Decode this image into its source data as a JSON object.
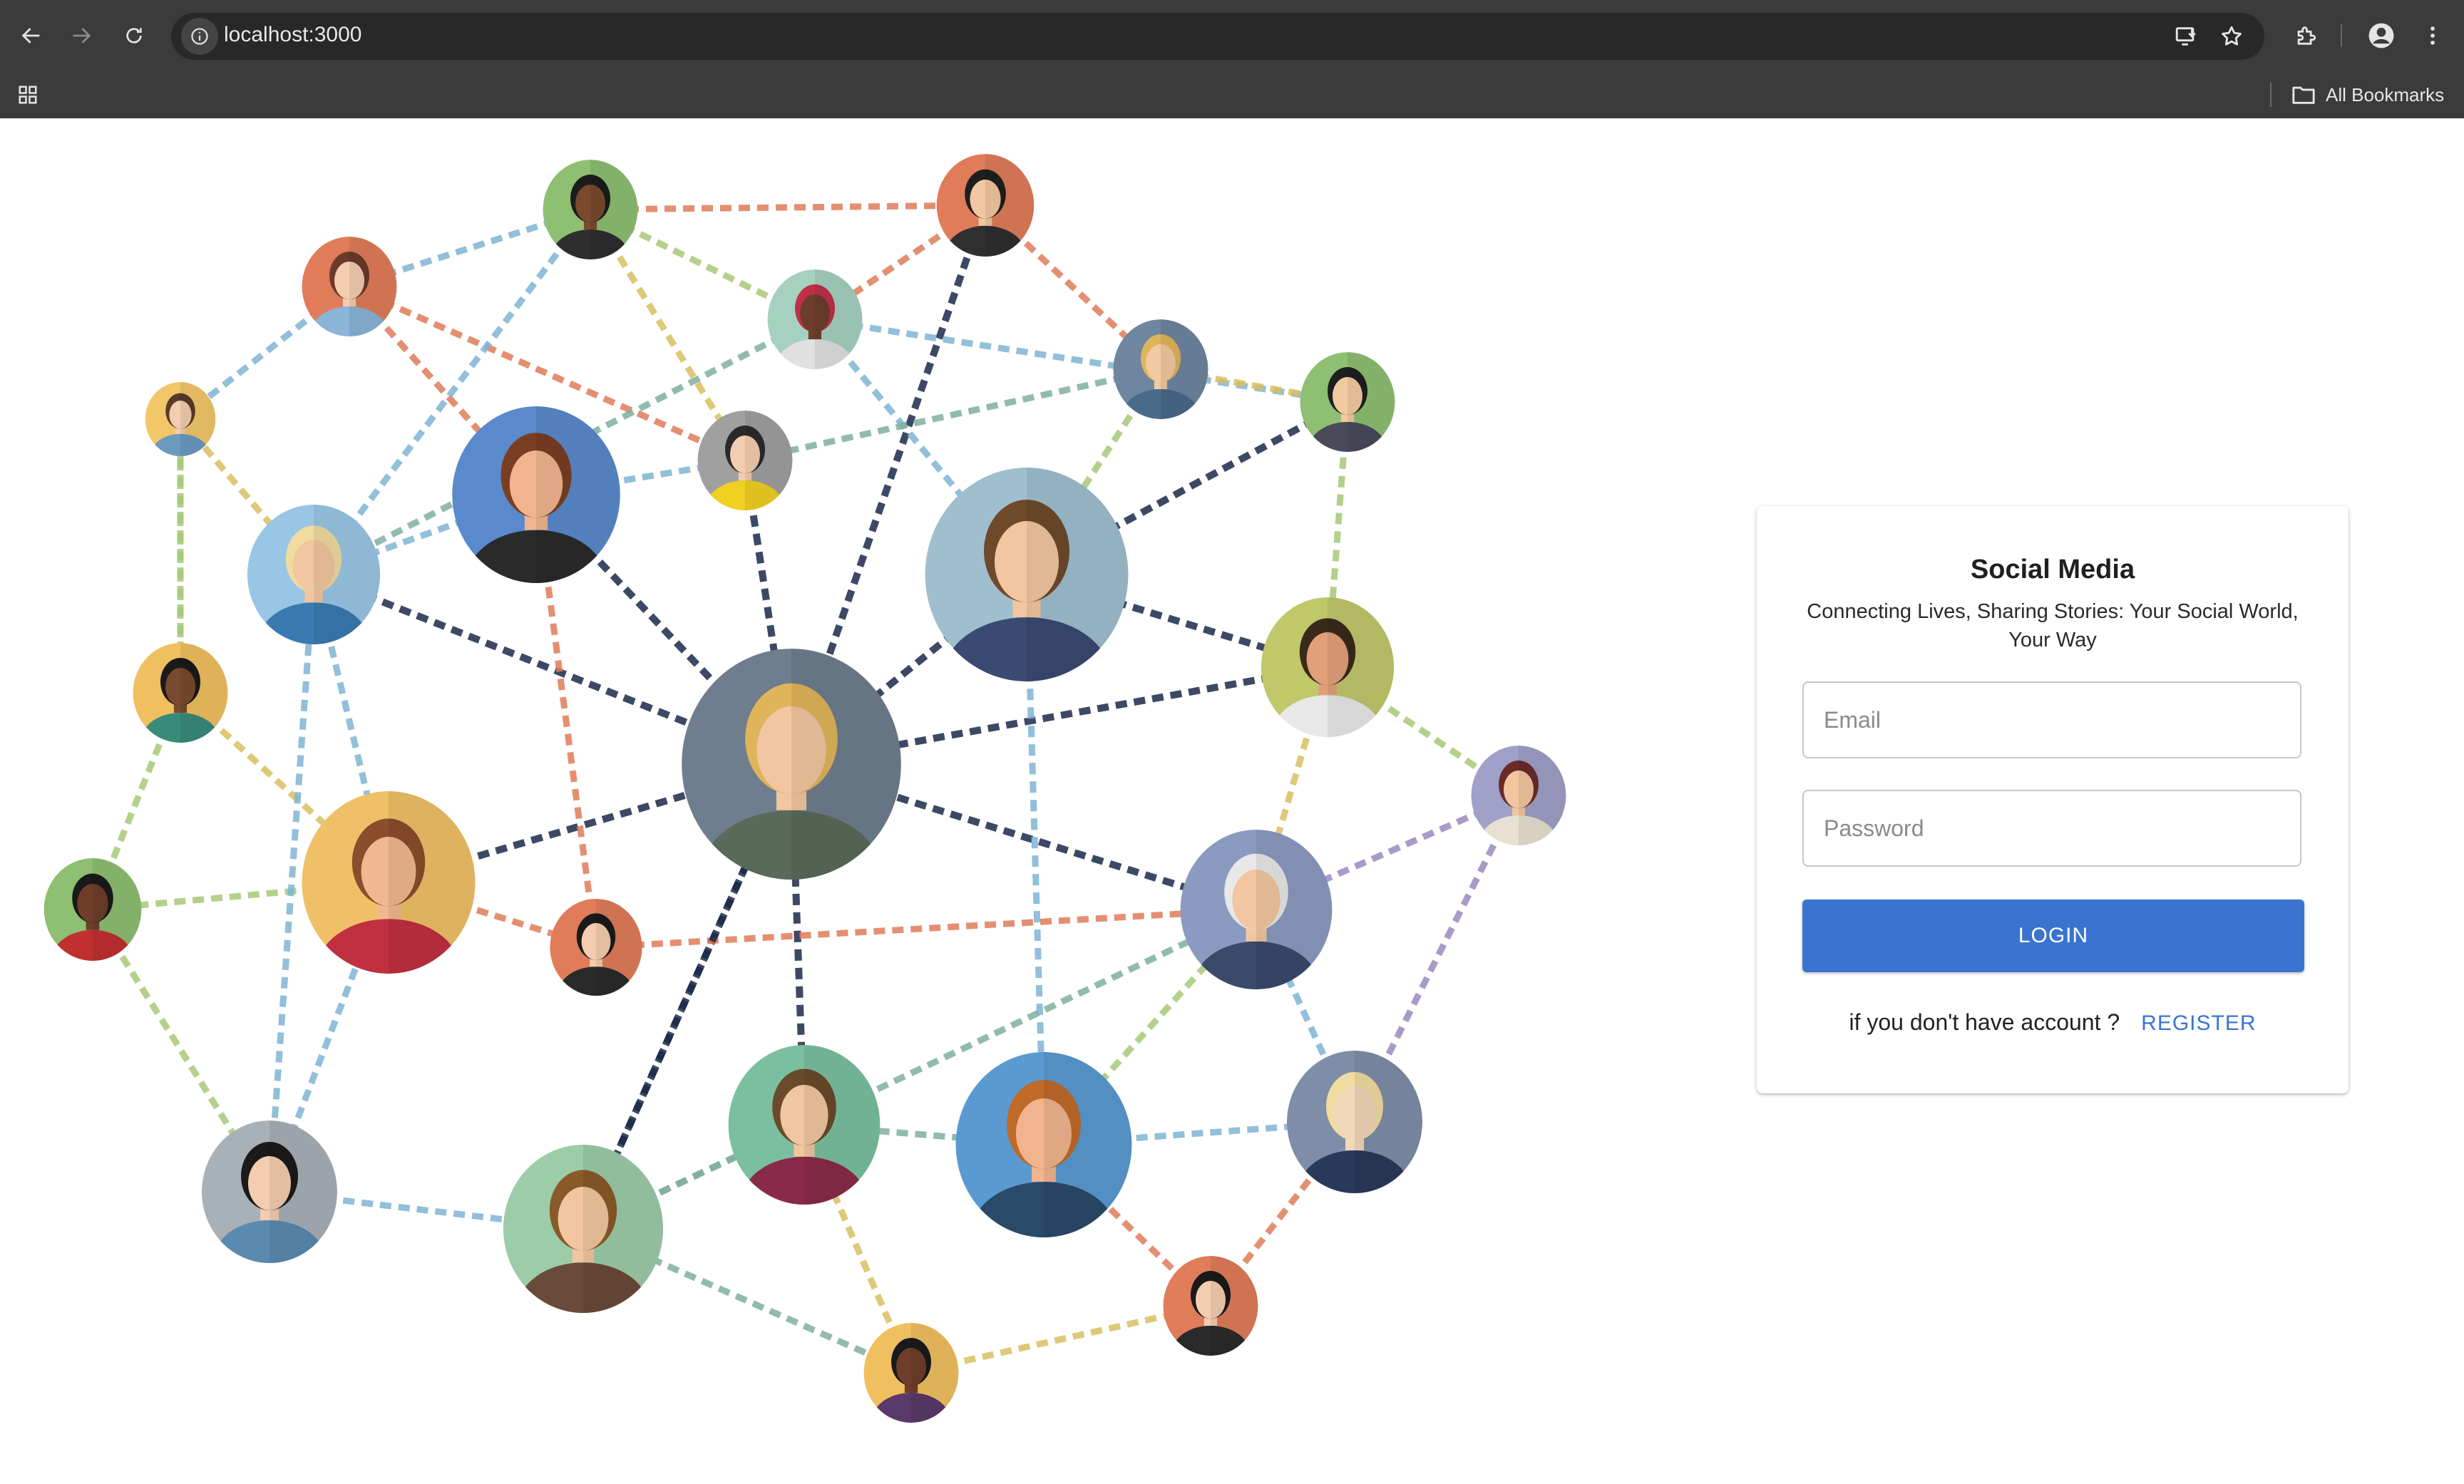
{
  "browser": {
    "url": "localhost:3000",
    "bookmarks_label": "All Bookmarks"
  },
  "login": {
    "title": "Social Media",
    "tagline": "Connecting Lives, Sharing Stories: Your Social World, Your Way",
    "email_placeholder": "Email",
    "password_placeholder": "Password",
    "login_label": "LOGIN",
    "register_prompt": "if you don't have account ?",
    "register_label": "REGISTER"
  },
  "colors": {
    "primary": "#3a74d0",
    "chrome": "#3b3b3b"
  }
}
